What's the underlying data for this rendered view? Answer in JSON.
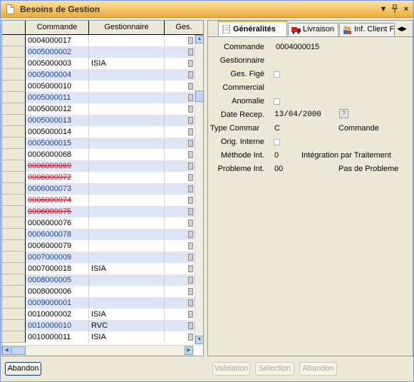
{
  "window": {
    "title": "Besoins de Gestion"
  },
  "grid": {
    "headers": {
      "commande": "Commande",
      "gestionnaire": "Gestionnaire",
      "ges": "Ges."
    },
    "rows": [
      {
        "commande": "0004000017",
        "gestionnaire": "",
        "alt": false,
        "strike": false
      },
      {
        "commande": "0005000002",
        "gestionnaire": "",
        "alt": true,
        "strike": false
      },
      {
        "commande": "0005000003",
        "gestionnaire": "ISIA",
        "alt": false,
        "strike": false
      },
      {
        "commande": "0005000004",
        "gestionnaire": "",
        "alt": true,
        "strike": false
      },
      {
        "commande": "0005000010",
        "gestionnaire": "",
        "alt": false,
        "strike": false
      },
      {
        "commande": "0005000011",
        "gestionnaire": "",
        "alt": true,
        "strike": false
      },
      {
        "commande": "0005000012",
        "gestionnaire": "",
        "alt": false,
        "strike": false
      },
      {
        "commande": "0005000013",
        "gestionnaire": "",
        "alt": true,
        "strike": false
      },
      {
        "commande": "0005000014",
        "gestionnaire": "",
        "alt": false,
        "strike": false
      },
      {
        "commande": "0005000015",
        "gestionnaire": "",
        "alt": true,
        "strike": false
      },
      {
        "commande": "0006000068",
        "gestionnaire": "",
        "alt": false,
        "strike": false
      },
      {
        "commande": "0006000069",
        "gestionnaire": "",
        "alt": true,
        "strike": true
      },
      {
        "commande": "0006000072",
        "gestionnaire": "",
        "alt": false,
        "strike": true
      },
      {
        "commande": "0006000073",
        "gestionnaire": "",
        "alt": true,
        "strike": false
      },
      {
        "commande": "0006000074",
        "gestionnaire": "",
        "alt": false,
        "strike": true
      },
      {
        "commande": "0006000075",
        "gestionnaire": "",
        "alt": true,
        "strike": true
      },
      {
        "commande": "0006000076",
        "gestionnaire": "",
        "alt": false,
        "strike": false
      },
      {
        "commande": "0006000078",
        "gestionnaire": "",
        "alt": true,
        "strike": false
      },
      {
        "commande": "0006000079",
        "gestionnaire": "",
        "alt": false,
        "strike": false
      },
      {
        "commande": "0007000009",
        "gestionnaire": "",
        "alt": true,
        "strike": false
      },
      {
        "commande": "0007000018",
        "gestionnaire": "ISIA",
        "alt": false,
        "strike": false
      },
      {
        "commande": "0008000005",
        "gestionnaire": "",
        "alt": true,
        "strike": false
      },
      {
        "commande": "0008000006",
        "gestionnaire": "",
        "alt": false,
        "strike": false
      },
      {
        "commande": "0009000001",
        "gestionnaire": "",
        "alt": true,
        "strike": false
      },
      {
        "commande": "0010000002",
        "gestionnaire": "ISIA",
        "alt": false,
        "strike": false
      },
      {
        "commande": "0010000010",
        "gestionnaire": "RVC",
        "alt": true,
        "strike": false
      },
      {
        "commande": "0010000011",
        "gestionnaire": "ISIA",
        "alt": false,
        "strike": false
      }
    ]
  },
  "tabs": [
    {
      "label": "Généralités",
      "icon": "document-icon",
      "active": true
    },
    {
      "label": "Livraison",
      "icon": "truck-icon",
      "active": false
    },
    {
      "label": "Inf. Client F",
      "icon": "users-icon",
      "active": false
    }
  ],
  "details": {
    "commande": {
      "label": "Commande",
      "value": "0004000015"
    },
    "gestionnaire": {
      "label": "Gestionnaire"
    },
    "ges_fige": {
      "label": "Ges. Figé"
    },
    "commercial": {
      "label": "Commercial"
    },
    "anomalie": {
      "label": "Anomalie"
    },
    "date_recep": {
      "label": "Date Recep.",
      "value": "13/04/2000"
    },
    "type_commande": {
      "label": "Type Commar",
      "code": "C",
      "text": "Commande"
    },
    "orig_interne": {
      "label": "Orig. Interne"
    },
    "methode_int": {
      "label": "Méthode Int.",
      "code": "0",
      "text": "Intégration par Traitement"
    },
    "probleme_int": {
      "label": "Probleme Int.",
      "code": "00",
      "text": "Pas de Probleme"
    }
  },
  "buttons": {
    "abandon_left": "Abandon",
    "validation": "Validation",
    "selection": "Sélection",
    "abandon_right": "Abandon"
  },
  "colors": {
    "titlebar": "#f4c469",
    "alt_row": "#dde5f7",
    "strike_text": "#c0102a",
    "active_tab_accent": "#f8b33a"
  }
}
